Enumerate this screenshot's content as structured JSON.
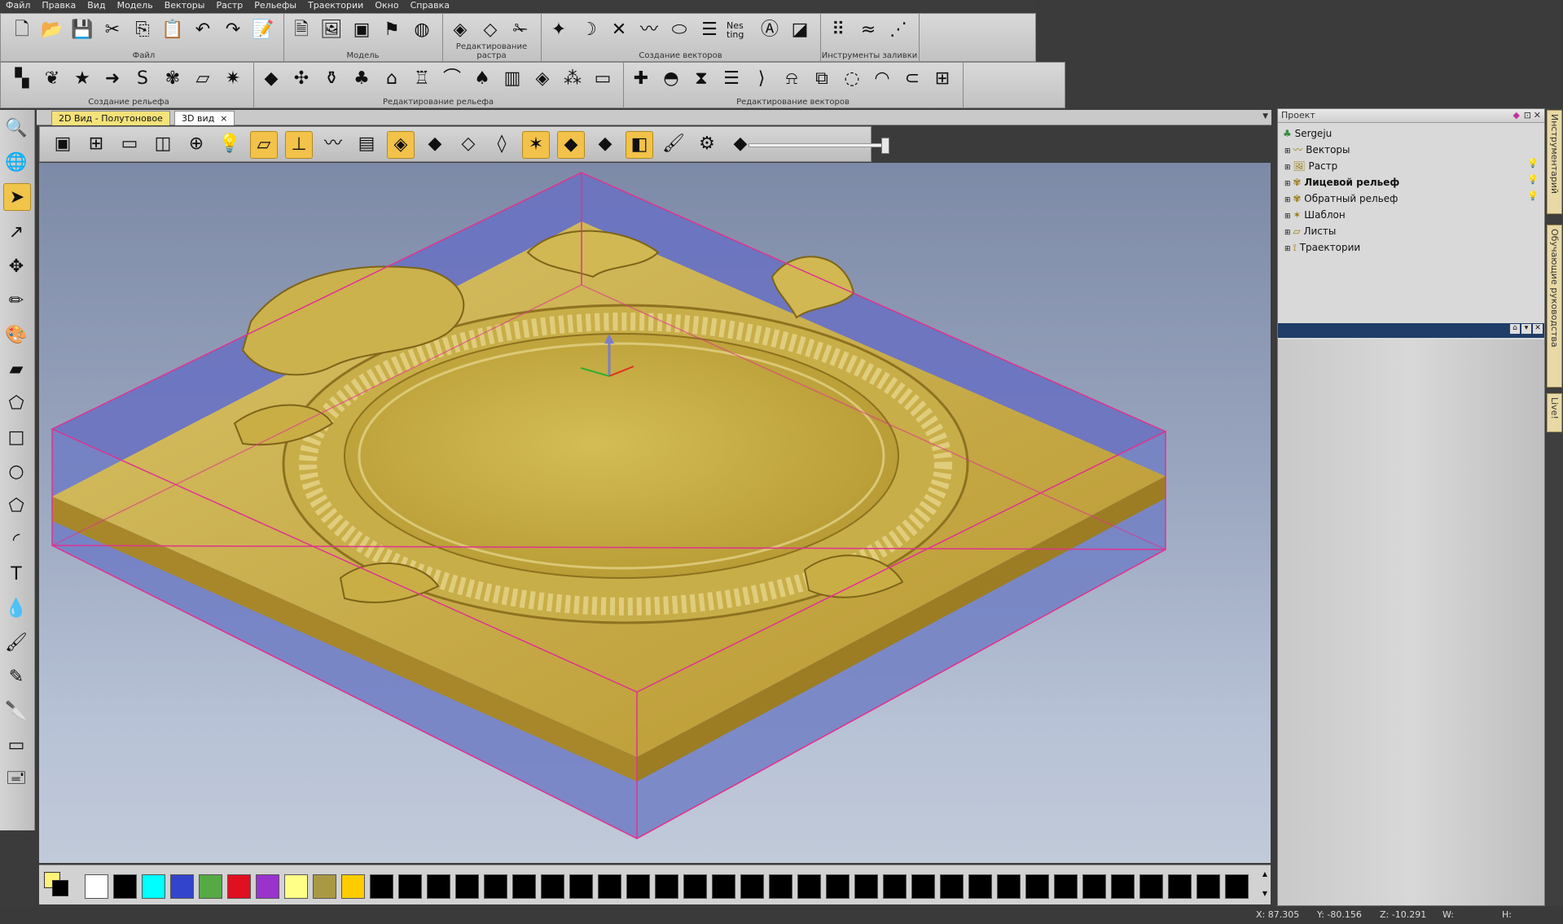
{
  "menu": [
    "Файл",
    "Правка",
    "Вид",
    "Модель",
    "Векторы",
    "Растр",
    "Рельефы",
    "Траектории",
    "Окно",
    "Справка"
  ],
  "toolbar_row1": {
    "groups": [
      {
        "label": "Файл",
        "icons": [
          "new-file",
          "open-folder",
          "save-disk",
          "cut-scissors",
          "copy",
          "paste",
          "undo-arrow",
          "redo-arrow",
          "notes-pencil"
        ]
      },
      {
        "label": "Модель",
        "icons": [
          "model-setup",
          "bitmap-import",
          "vector-import",
          "red-model",
          "sphere-mesh"
        ]
      },
      {
        "label": "Редактирование растра",
        "icons": [
          "raster-edit",
          "raster-select",
          "raster-scissors"
        ]
      },
      {
        "label": "Создание векторов",
        "icons": [
          "star-vector",
          "arc-vector",
          "cross-vector",
          "bezier-vector",
          "oval-vector",
          "stack-vector",
          "nesting",
          "text-vector",
          "layers-vector"
        ]
      },
      {
        "label": "Инструменты заливки",
        "icons": [
          "fill-dots",
          "fill-wave",
          "fill-nodes"
        ]
      }
    ],
    "nesting_text": "Nes ting"
  },
  "toolbar_row2": {
    "groups": [
      {
        "label": "Создание рельефа",
        "icons": [
          "relief-shapes",
          "leaf-relief",
          "star-relief",
          "arrow-relief",
          "s-curve",
          "knot-relief",
          "slab-relief",
          "sparkle-relief"
        ]
      },
      {
        "label": "Редактирование рельефа",
        "icons": [
          "plane-relief",
          "smooth",
          "vase",
          "tree-relief",
          "bottle",
          "tool",
          "arch",
          "mushroom",
          "column",
          "diamond",
          "texture",
          "eraser-relief"
        ]
      },
      {
        "label": "Редактирование векторов",
        "icons": [
          "add-plus",
          "bowl",
          "node-edit",
          "stripes",
          "bracket",
          "bell",
          "trim",
          "shape-1",
          "shape-2",
          "shape-3",
          "transform-box"
        ]
      }
    ]
  },
  "tabs": [
    {
      "label": "2D Вид - Полутоновое",
      "active": false
    },
    {
      "label": "3D вид",
      "active": true
    }
  ],
  "tab_close": "×",
  "view3d_tools": [
    "iso-view",
    "top-view",
    "front-view",
    "side-view",
    "zoom-fit",
    "light-bulb",
    "show-plane",
    "axes",
    "show-vectors",
    "show-bitmap",
    "show-relief",
    "show-shaded",
    "show-wire",
    "show-sheet",
    "star-mark",
    "show-material",
    "show-solid",
    "render-tool",
    "paint-tool",
    "settings-gear",
    "diamond-tool"
  ],
  "palette": {
    "current_fg": "#fff27a",
    "current_bg": "#000000",
    "colors": [
      "#ffffff",
      "#000000",
      "#00ffff",
      "#3344cc",
      "#55aa44",
      "#e01020",
      "#9933cc",
      "#ffff88",
      "#aa9944",
      "#ffcc00",
      "#000000",
      "#000000",
      "#000000",
      "#000000",
      "#000000",
      "#000000",
      "#000000",
      "#000000",
      "#000000",
      "#000000",
      "#000000",
      "#000000",
      "#000000",
      "#000000",
      "#000000",
      "#000000",
      "#000000",
      "#000000",
      "#000000",
      "#000000",
      "#000000",
      "#000000",
      "#000000",
      "#000000",
      "#000000",
      "#000000",
      "#000000",
      "#000000",
      "#000000",
      "#000000",
      "#000000"
    ]
  },
  "project": {
    "title": "Проект",
    "root": "Sergeju",
    "items": [
      "Векторы",
      "Растр",
      "Лицевой рельеф",
      "Обратный рельеф",
      "Шаблон",
      "Листы",
      "Траектории"
    ],
    "bold_items": [
      "Лицевой рельеф"
    ]
  },
  "side_tabs": [
    "Инструментарий",
    "Обучающие руководства",
    "Live!"
  ],
  "status": {
    "x": "X: 87.305",
    "y": "Y: -80.156",
    "z": "Z: -10.291",
    "w": "W:",
    "h": "H:"
  },
  "colors": {
    "accent_gold": "#c7a83a",
    "bounding_box": "#e0338f",
    "block_blue": "#6a73c0",
    "tab_active": "#f4e27a"
  }
}
